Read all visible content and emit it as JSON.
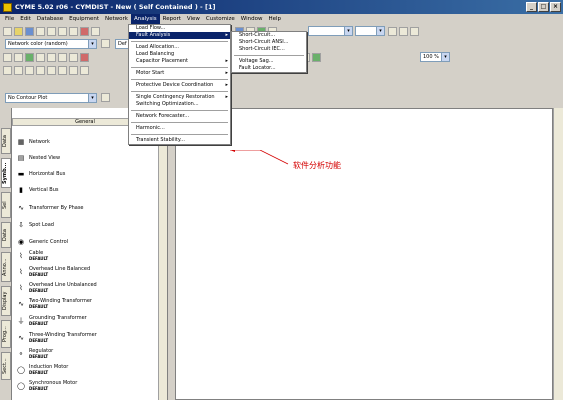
{
  "window": {
    "title": "CYME 5.02 r06 - CYMDIST - New ( Self Contained ) - [1]",
    "buttons": [
      "_",
      "□",
      "×"
    ]
  },
  "menubar": {
    "items": [
      "File",
      "Edit",
      "Database",
      "Equipment",
      "Network",
      "Analysis",
      "Report",
      "View",
      "Customize",
      "Window",
      "Help"
    ],
    "active_index": 5
  },
  "toolbar": {
    "network_color_combo": "Network color (random)",
    "second_combo": "Def",
    "contour_combo": "No Contour Plot",
    "zoom_combo": "100 %"
  },
  "analysis_menu": {
    "items": [
      "Load Flow...",
      "Fault Analysis",
      "Load Allocation...",
      "Load Balancing",
      "Capacitor Placement",
      "Motor Start",
      "Protective Device Coordination",
      "Single Contingency Restoration",
      "Switching Optimization...",
      "Network Forecaster...",
      "Harmonic...",
      "Transient Stability..."
    ],
    "highlight_index": 1
  },
  "fault_submenu": {
    "items": [
      "Short-Circuit...",
      "Short-Circuit ANSI...",
      "Short-Circuit IEC...",
      "Voltage Sag...",
      "Fault Locator..."
    ]
  },
  "palette": {
    "header": "General",
    "tabs": [
      "Data",
      "Symb...",
      "Sel",
      "Data",
      "Anno...",
      "Display",
      "Prog...",
      "Sect..."
    ],
    "items": [
      {
        "label": "Network",
        "sub": ""
      },
      {
        "label": "Nested View",
        "sub": ""
      },
      {
        "label": "Horizontal Bus",
        "sub": ""
      },
      {
        "label": "Vertical Bus",
        "sub": ""
      },
      {
        "label": "Transformer By Phase",
        "sub": ""
      },
      {
        "label": "Spot Load",
        "sub": ""
      },
      {
        "label": "Generic Control",
        "sub": ""
      },
      {
        "label": "Cable",
        "sub": "DEFAULT"
      },
      {
        "label": "Overhead Line Balanced",
        "sub": "DEFAULT"
      },
      {
        "label": "Overhead Line Unbalanced",
        "sub": "DEFAULT"
      },
      {
        "label": "Two-Winding Transformer",
        "sub": "DEFAULT"
      },
      {
        "label": "Grounding Transformer",
        "sub": "DEFAULT"
      },
      {
        "label": "Three-Winding Transformer",
        "sub": "DEFAULT"
      },
      {
        "label": "Regulator",
        "sub": "DEFAULT"
      },
      {
        "label": "Induction Motor",
        "sub": "DEFAULT"
      },
      {
        "label": "Synchronous Motor",
        "sub": "DEFAULT"
      }
    ]
  },
  "annotation": {
    "text": "软件分析功能"
  }
}
